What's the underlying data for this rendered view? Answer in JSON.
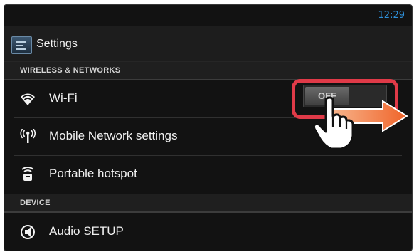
{
  "status_bar": {
    "time": "12:29"
  },
  "action_bar": {
    "title": "Settings",
    "icon": "settings-app-icon"
  },
  "sections": {
    "wireless": {
      "header": "WIRELESS & NETWORKS"
    },
    "device": {
      "header": "DEVICE"
    }
  },
  "items": {
    "wifi": {
      "label": "Wi-Fi",
      "icon": "wifi-icon",
      "toggle_state": "OFF"
    },
    "mobile": {
      "label": "Mobile Network settings",
      "icon": "antenna-icon"
    },
    "hotspot": {
      "label": "Portable hotspot",
      "icon": "hotspot-icon"
    },
    "audio": {
      "label": "Audio SETUP",
      "icon": "audio-icon"
    }
  },
  "overlay": {
    "highlight_color": "#e03a48",
    "arrow_color": "#f0642a",
    "gesture_icon": "hand-pointer-icon"
  }
}
